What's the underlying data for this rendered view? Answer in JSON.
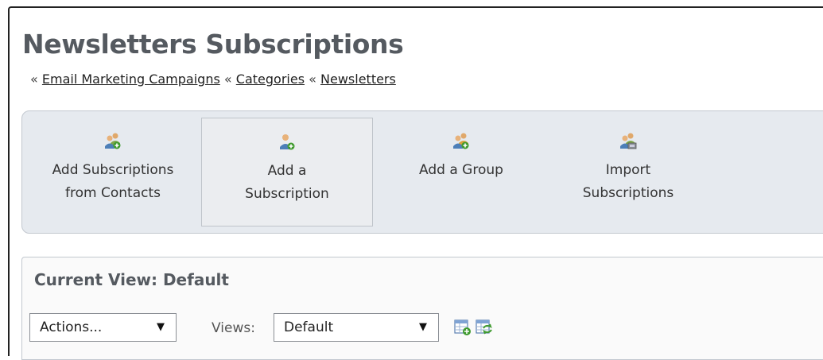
{
  "header": {
    "title": "Newsletters Subscriptions"
  },
  "breadcrumb": {
    "separator": "«",
    "items": [
      {
        "label": "Email Marketing Campaigns"
      },
      {
        "label": "Categories"
      },
      {
        "label": "Newsletters"
      }
    ]
  },
  "toolbar": {
    "items": [
      {
        "label": "Add Subscriptions\nfrom Contacts",
        "icon": "users-add-icon",
        "selected": false
      },
      {
        "label": "Add a\nSubscription",
        "icon": "user-add-icon",
        "selected": true
      },
      {
        "label": "Add a Group",
        "icon": "group-add-icon",
        "selected": false
      },
      {
        "label": "Import\nSubscriptions",
        "icon": "users-import-icon",
        "selected": false
      }
    ]
  },
  "view_panel": {
    "title": "Current View: Default",
    "actions": {
      "selected": "Actions...",
      "arrow": "▼"
    },
    "views": {
      "label": "Views:",
      "selected": "Default",
      "arrow": "▼"
    },
    "icons": [
      "add-view-icon",
      "refresh-view-icon"
    ]
  },
  "colors": {
    "title": "#555a60",
    "toolbar_bg": "#e6eaef",
    "toolbar_border": "#c2c8cf"
  }
}
